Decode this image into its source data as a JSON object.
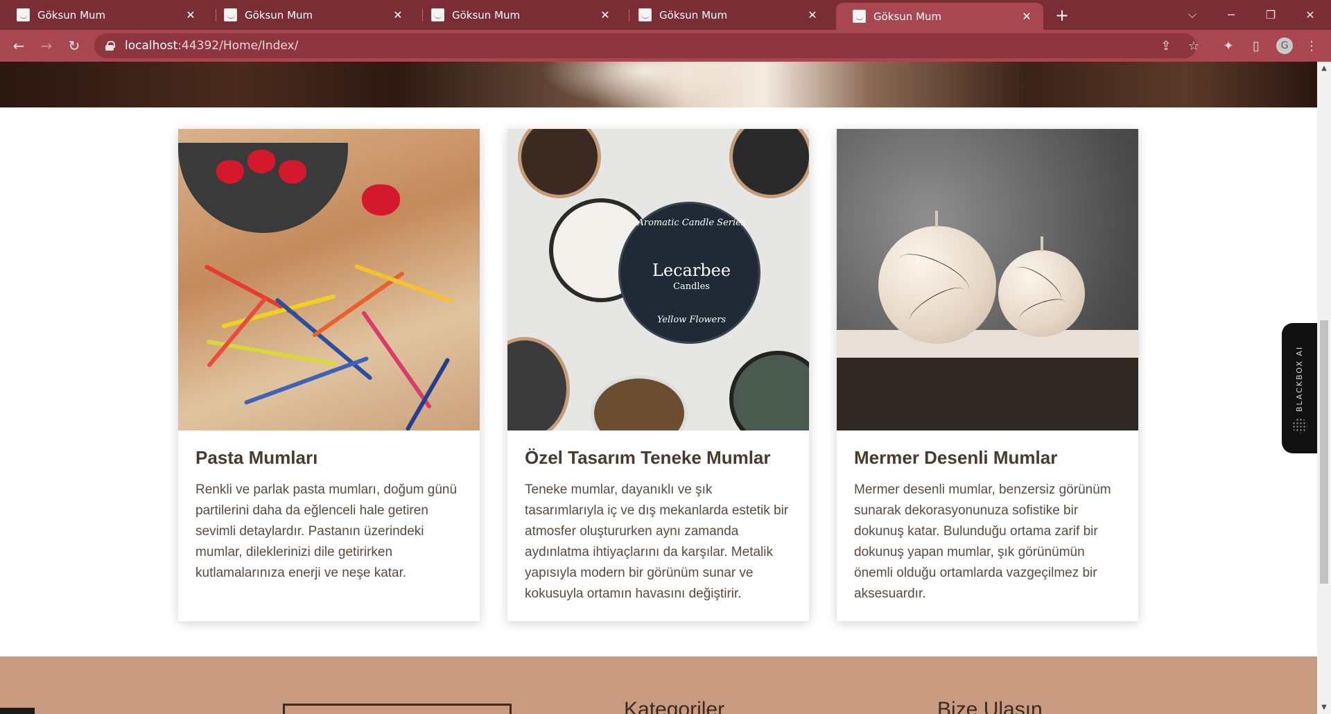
{
  "browser": {
    "tabs": [
      {
        "title": "Göksun Mum",
        "active": false
      },
      {
        "title": "Göksun Mum",
        "active": false
      },
      {
        "title": "Göksun Mum",
        "active": false
      },
      {
        "title": "Göksun Mum",
        "active": false
      },
      {
        "title": "Göksun Mum",
        "active": true
      }
    ],
    "new_tab_glyph": "+",
    "address_bar": {
      "host": "localhost",
      "path": ":44392/Home/Index/"
    },
    "profile_initial": "G"
  },
  "cards": [
    {
      "title": "Pasta Mumları",
      "text": "Renkli ve parlak pasta mumları, doğum günü partilerini daha da eğlenceli hale getiren sevimli detaylardır. Pastanın üzerindeki mumlar, dileklerinizi dile getirirken kutlamalarınıza enerji ve neşe katar."
    },
    {
      "title": "Özel Tasarım Teneke Mumlar",
      "text": "Teneke mumlar, dayanıklı ve şık tasarımlarıyla iç ve dış mekanlarda estetik bir atmosfer oluştururken aynı zamanda aydınlatma ihtiyaçlarını da karşılar. Metalik yapısıyla modern bir görünüm sunar ve kokusuyla ortamın havasını değiştirir.",
      "image_text": {
        "brand": "Lecarbee",
        "sub": "Candles",
        "ring_top": "Aromatic Candle Series",
        "ring_bottom": "Yellow Flowers"
      }
    },
    {
      "title": "Mermer Desenli Mumlar",
      "text": "Mermer desenli mumlar, benzersiz görünüm sunarak dekorasyonunuza sofistike bir dokunuş katar. Bulunduğu ortama zarif bir dokunuş yapan mumlar, şık görünümün önemli olduğu ortamlarda vazgeçilmez bir aksesuardır."
    }
  ],
  "extension_widget": {
    "label": "BLACKBOX AI"
  },
  "footer": {
    "headings": [
      "Kategoriler",
      "Bize Ulaşın"
    ]
  },
  "colors": {
    "tab_bar": "#7b2d36",
    "toolbar": "#a8474f",
    "footer": "#c89a7f",
    "card_title": "#4a3a2e"
  }
}
